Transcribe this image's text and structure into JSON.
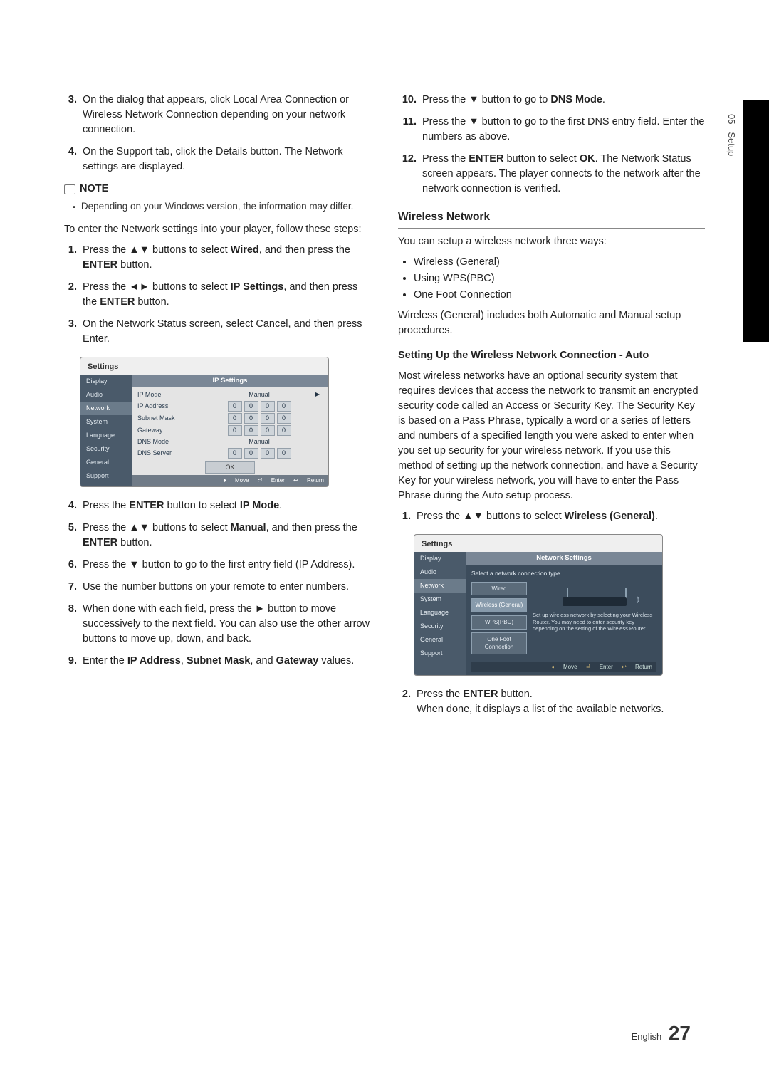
{
  "sideTab": {
    "section": "05",
    "name": "Setup"
  },
  "left": {
    "step3": "On the dialog that appears, click Local Area Connection or Wireless Network Connection depending on your network connection.",
    "step4": "On the Support tab, click the Details button. The Network settings are displayed.",
    "noteLabel": "NOTE",
    "noteItem": "Depending on your Windows version, the information may differ.",
    "intro": "To enter the Network settings into your player, follow these steps:",
    "s1_a": "Press the ▲▼ buttons to select ",
    "s1_b": "Wired",
    "s1_c": ", and then press the ",
    "s1_d": "ENTER",
    "s1_e": " button.",
    "s2_a": "Press the ◄► buttons to select ",
    "s2_b": "IP Settings",
    "s2_c": ", and then press the ",
    "s2_d": "ENTER",
    "s2_e": " button.",
    "s3": "On the Network Status screen, select Cancel, and then press Enter.",
    "s4_a": "Press the ",
    "s4_b": "ENTER",
    "s4_c": " button to select ",
    "s4_d": "IP Mode",
    "s4_e": ".",
    "s5_a": "Press the ▲▼ buttons to select ",
    "s5_b": "Manual",
    "s5_c": ", and then press the ",
    "s5_d": "ENTER",
    "s5_e": " button.",
    "s6": "Press the ▼ button to go to the first entry field (IP Address).",
    "s7": "Use the number buttons on your remote to enter numbers.",
    "s8": "When done with each field, press the ► button to move successively to the next field. You can also use the other arrow buttons to move up, down, and back.",
    "s9_a": "Enter the ",
    "s9_b": "IP Address",
    "s9_c": ", ",
    "s9_d": "Subnet Mask",
    "s9_e": ", and ",
    "s9_f": "Gateway",
    "s9_g": " values."
  },
  "right": {
    "s10_a": "Press the ▼ button to go to ",
    "s10_b": "DNS Mode",
    "s10_c": ".",
    "s11": "Press the ▼ button to go to the first DNS entry field. Enter the numbers as above.",
    "s12_a": "Press the ",
    "s12_b": "ENTER",
    "s12_c": " button to select ",
    "s12_d": "OK",
    "s12_e": ". The Network Status screen appears. The player connects to the network after the network connection is verified.",
    "wirelessHead": "Wireless Network",
    "wIntro": "You can setup a wireless network three ways:",
    "wOpt1": "Wireless (General)",
    "wOpt2": "Using WPS(PBC)",
    "wOpt3": "One Foot Connection",
    "wNote": "Wireless (General) includes both Automatic and Manual setup procedures.",
    "autoHead": "Setting Up the Wireless Network Connection - Auto",
    "autoPara": "Most wireless networks have an optional security system that requires devices that access the network to transmit an encrypted security code called an Access or Security Key. The Security Key is based on a Pass Phrase, typically a word or a series of letters and numbers of a specified length you were asked to enter when you set up security for your wireless network. If you use this method of setting up the network connection, and have a Security Key for your wireless network, you will have to enter the Pass Phrase during the Auto setup process.",
    "a1_a": "Press the ▲▼ buttons to select ",
    "a1_b": "Wireless (General)",
    "a1_c": ".",
    "a2_a": "Press the ",
    "a2_b": "ENTER",
    "a2_c": " button.",
    "a2_d": "When done, it displays a list of the available networks."
  },
  "mock1": {
    "title": "Settings",
    "paneHead": "IP Settings",
    "side": [
      "Display",
      "Audio",
      "Network",
      "System",
      "Language",
      "Security",
      "General",
      "Support"
    ],
    "rows": {
      "ipModeK": "IP Mode",
      "ipModeV": "Manual",
      "ipAddrK": "IP Address",
      "subnetK": "Subnet Mask",
      "gatewayK": "Gateway",
      "dnsModeK": "DNS Mode",
      "dnsModeV": "Manual",
      "dnsServK": "DNS Server"
    },
    "zero": "0",
    "ok": "OK",
    "hints": {
      "move": "Move",
      "enter": "Enter",
      "return": "Return"
    }
  },
  "mock2": {
    "title": "Settings",
    "paneHead": "Network Settings",
    "side": [
      "Display",
      "Audio",
      "Network",
      "System",
      "Language",
      "Security",
      "General",
      "Support"
    ],
    "prompt": "Select a network connection type.",
    "opts": [
      "Wired",
      "Wireless (General)",
      "WPS(PBC)",
      "One Foot Connection"
    ],
    "desc": "Set up wireless network by selecting your Wireless Router. You may need to enter security key depending on the setting of the Wireless Router.",
    "hints": {
      "move": "Move",
      "enter": "Enter",
      "return": "Return"
    }
  },
  "footer": {
    "lang": "English",
    "page": "27"
  }
}
